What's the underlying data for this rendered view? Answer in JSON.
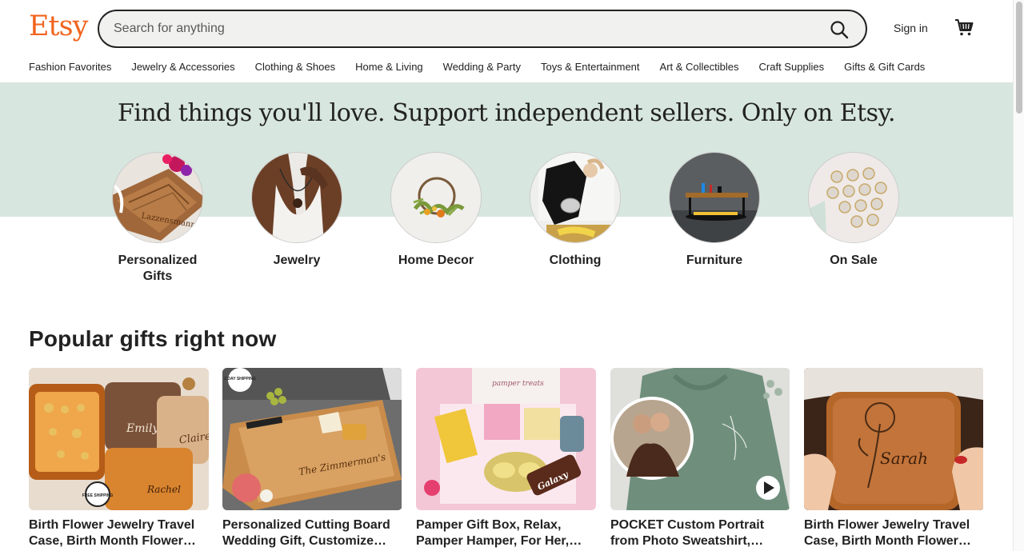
{
  "header": {
    "logo": "Etsy",
    "search_placeholder": "Search for anything",
    "sign_in": "Sign in"
  },
  "nav": [
    "Fashion Favorites",
    "Jewelry & Accessories",
    "Clothing & Shoes",
    "Home & Living",
    "Wedding & Party",
    "Toys & Entertainment",
    "Art & Collectibles",
    "Craft Supplies",
    "Gifts & Gift Cards"
  ],
  "hero": {
    "title": "Find things you'll love. Support independent sellers. Only on Etsy."
  },
  "categories": [
    {
      "line1": "Personalized",
      "line2": "Gifts"
    },
    {
      "line1": "Jewelry",
      "line2": ""
    },
    {
      "line1": "Home Decor",
      "line2": ""
    },
    {
      "line1": "Clothing",
      "line2": ""
    },
    {
      "line1": "Furniture",
      "line2": ""
    },
    {
      "line1": "On Sale",
      "line2": ""
    }
  ],
  "popular": {
    "title": "Popular gifts right now",
    "items": [
      {
        "title1": "Birth Flower Jewelry Travel",
        "title2": "Case, Birth Month Flower…",
        "image_text": "Emily",
        "image_text2": "Claire",
        "image_text3": "Rachel",
        "badge": "FREE SHIPPING"
      },
      {
        "title1": "Personalized Cutting Board",
        "title2": "Wedding Gift, Customize…",
        "badge": "2 DAY SHIPPING",
        "image_text": "The Zimmerman's"
      },
      {
        "title1": "Pamper Gift Box, Relax,",
        "title2": "Pamper Hamper, For Her,…",
        "image_text": "pamper treats",
        "image_text2": "Galaxy"
      },
      {
        "title1": "POCKET Custom Portrait",
        "title2": "from Photo Sweatshirt,…"
      },
      {
        "title1": "Birth Flower Jewelry Travel",
        "title2": "Case, Birth Month Flower…",
        "image_text": "Sarah"
      }
    ]
  },
  "colors": {
    "brand": "#f1641e",
    "hero_bg": "#d7e6de"
  }
}
